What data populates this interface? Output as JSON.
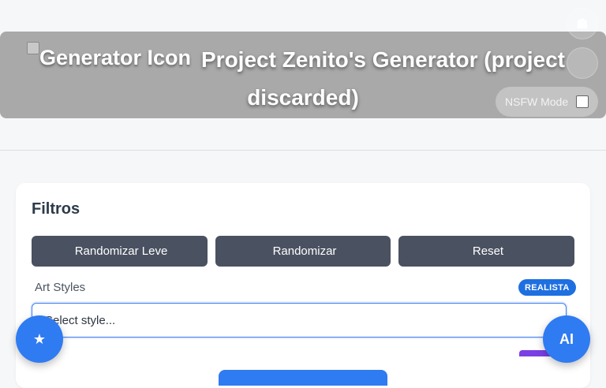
{
  "header": {
    "logo_alt": "Generator Icon",
    "title_line1": "Project Zenito's Generator (project",
    "title_line2": "discarded)",
    "top_icon": "☗",
    "side_icon": "",
    "nsfw_label": "NSFW Mode",
    "nsfw_checked": false
  },
  "filters": {
    "title": "Filtros",
    "buttons": [
      {
        "icon": "",
        "label": "Randomizar Leve"
      },
      {
        "icon": "",
        "label": "Randomizar"
      },
      {
        "icon": "",
        "label": "Reset"
      }
    ],
    "art_styles": {
      "icon": "",
      "label": "Art Styles",
      "badge": "REALISTA",
      "placeholder": "Select style..."
    }
  },
  "fabs": {
    "left_icon": "★",
    "right_label": "AI"
  },
  "colors": {
    "accent": "#2f7bf2",
    "header_bg": "#a9a9a9",
    "button_bg": "#4a5160",
    "badge_purple": "#7b3fe4"
  }
}
